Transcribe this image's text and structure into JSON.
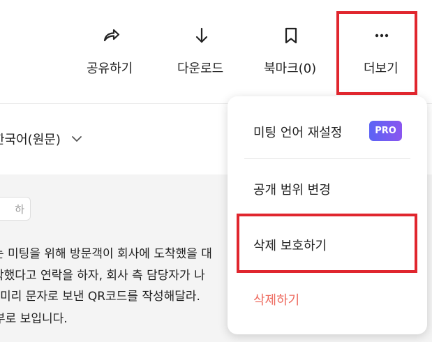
{
  "toolbar": {
    "share": {
      "label": "공유하기",
      "icon": "share-arrow-icon"
    },
    "download": {
      "label": "다운로드",
      "icon": "download-arrow-icon"
    },
    "bookmark": {
      "label": "북마크(0)",
      "icon": "bookmark-icon"
    },
    "more": {
      "label": "더보기",
      "icon": "more-dots-icon"
    }
  },
  "language": {
    "selected": "한국어(원문)",
    "icon": "chevron-down-icon"
  },
  "content": {
    "side_button_text": "하",
    "lines": [
      "는 미팅을 위해 방문객이 회사에 도착했을 대",
      "착했다고 연락을 하자, 회사 측 담당자가 나",
      "l 미리 문자로 보낸 QR코드를 작성해달라.",
      "부로 보입니다."
    ]
  },
  "menu": {
    "items": [
      {
        "label": "미팅 언어 재설정",
        "badge": "PRO"
      },
      {
        "label": "공개 범위 변경"
      },
      {
        "label": "삭제 보호하기"
      },
      {
        "label": "삭제하기"
      }
    ]
  },
  "colors": {
    "highlight": "#e0262e",
    "danger_text": "#ee6a5e",
    "badge_gradient_start": "#5b63f5",
    "badge_gradient_end": "#8a56ef",
    "content_background": "#f4f4f4"
  }
}
